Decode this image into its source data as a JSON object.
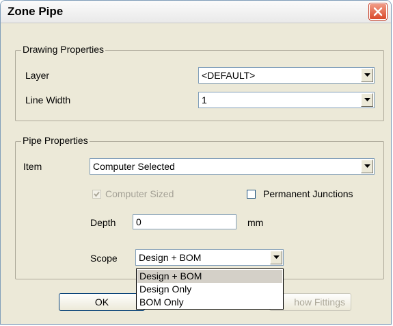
{
  "window": {
    "title": "Zone Pipe"
  },
  "drawing": {
    "legend": "Drawing Properties",
    "layer_label": "Layer",
    "layer_value": "<DEFAULT>",
    "line_width_label": "Line Width",
    "line_width_value": "1"
  },
  "pipe": {
    "legend": "Pipe Properties",
    "item_label": "Item",
    "item_value": "Computer Selected",
    "computer_sized_label": "Computer Sized",
    "computer_sized_checked": true,
    "permanent_junctions_label": "Permanent Junctions",
    "permanent_junctions_checked": false,
    "depth_label": "Depth",
    "depth_value": "0",
    "depth_unit": "mm",
    "scope_label": "Scope",
    "scope_value": "Design + BOM",
    "scope_options": [
      "Design + BOM",
      "Design Only",
      "BOM Only"
    ]
  },
  "buttons": {
    "ok": "OK",
    "show_fittings": "how Fittings"
  },
  "icons": {
    "close": "close-icon",
    "dropdown": "dropdown-arrow-icon",
    "check": "checkmark-icon"
  }
}
